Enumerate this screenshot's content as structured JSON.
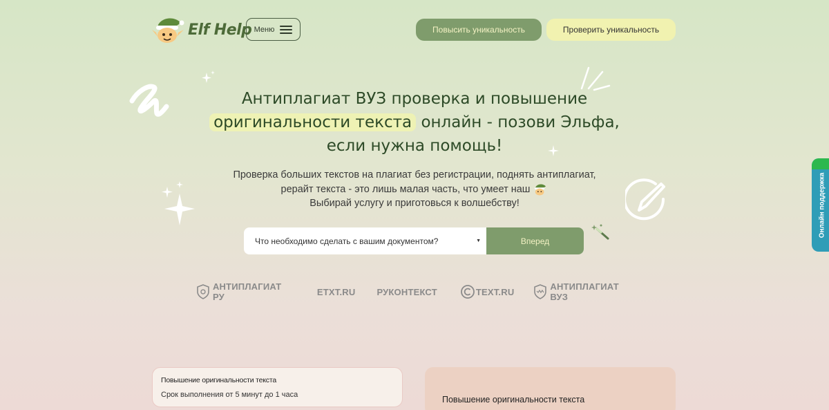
{
  "header": {
    "logo_text": "Elf Help",
    "menu_label": "Меню",
    "improve_button": "Повысить уникальность",
    "check_button": "Проверить уникальность"
  },
  "hero": {
    "title_part1": "Антиплагиат ВУЗ проверка и повышение",
    "title_highlight": "оригинальности текста",
    "title_part2": " онлайн - позови Эльфа, если нужна помощь!",
    "subtitle_part1": "Проверка больших текстов на плагиат без регистрации, поднять антиплагиат, рерайт текста - это лишь малая часть, что умеет наш",
    "subtitle_part2": "Выбирай услугу и приготовься к волшебству!"
  },
  "search": {
    "select_value": "Что необходимо сделать с вашим документом?",
    "go_button": "Вперед"
  },
  "partners": [
    "АНТИПЛАГИАТ РУ",
    "ETXT.RU",
    "РУКОНТЕКСТ",
    "TEXT.RU",
    "АНТИПЛАГИАТ ВУЗ"
  ],
  "cards": {
    "card1_title": "Повышение оригинальности текста",
    "card1_term": "Срок выполнения от 5 минут до 1 часа",
    "card2_title": "Повышение оригинальности текста"
  },
  "support_tab": "Онлайн поддержка",
  "colors": {
    "accent_green": "#7f9c6c",
    "accent_yellow": "#f1f2b0",
    "support_blue": "#2f9db7"
  }
}
